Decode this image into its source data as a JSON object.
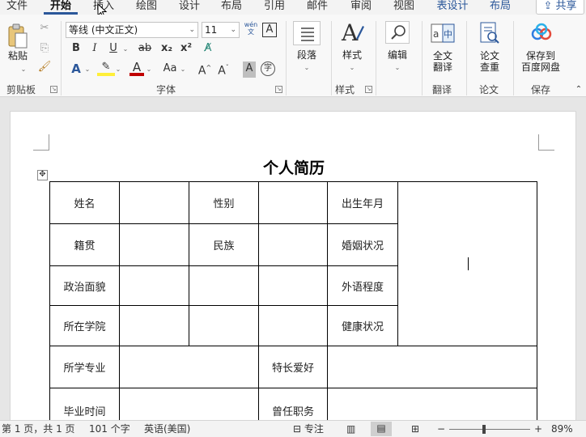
{
  "tabs": [
    {
      "label": "文件"
    },
    {
      "label": "开始"
    },
    {
      "label": "插入"
    },
    {
      "label": "绘图"
    },
    {
      "label": "设计"
    },
    {
      "label": "布局"
    },
    {
      "label": "引用"
    },
    {
      "label": "邮件"
    },
    {
      "label": "审阅"
    },
    {
      "label": "视图"
    },
    {
      "label": "表设计"
    },
    {
      "label": "布局"
    }
  ],
  "share_label": "共享",
  "ribbon": {
    "clipboard": {
      "paste_label": "粘贴",
      "group_label": "剪贴板"
    },
    "font": {
      "font_name": "等线 (中文正文)",
      "font_size": "11",
      "group_label": "字体",
      "bold": "B",
      "italic": "I",
      "underline": "U",
      "strike": "ab",
      "subscript": "x₂",
      "superscript": "x²",
      "grow": "A^",
      "shrink": "Aˇ",
      "case": "Aa",
      "phonetic": "wén 文",
      "char_border": "A",
      "char_shading": "A",
      "enclose": "字"
    },
    "paragraph": {
      "label": "段落"
    },
    "styles": {
      "label": "样式",
      "group_label": "样式"
    },
    "editing": {
      "label": "编辑"
    },
    "translate": {
      "line1": "全文",
      "line2": "翻译",
      "group_label": "翻译"
    },
    "paper": {
      "line1": "论文",
      "line2": "查重",
      "group_label": "论文"
    },
    "save": {
      "line1": "保存到",
      "line2": "百度网盘",
      "group_label": "保存"
    }
  },
  "accent_color": "#2b579a",
  "document": {
    "title": "个人简历",
    "cells": {
      "name": "姓名",
      "gender": "性别",
      "birth": "出生年月",
      "native": "籍贯",
      "ethnic": "民族",
      "marital": "婚姻状况",
      "political": "政治面貌",
      "foreign_lang": "外语程度",
      "college": "所在学院",
      "health": "健康状况",
      "major": "所学专业",
      "hobby": "特长爱好",
      "graduation": "毕业时间",
      "position": "曾任职务"
    }
  },
  "status": {
    "page": "第 1 页，共 1 页",
    "words": "101 个字",
    "language": "英语(美国)",
    "focus": "专注",
    "zoom": "89%"
  }
}
